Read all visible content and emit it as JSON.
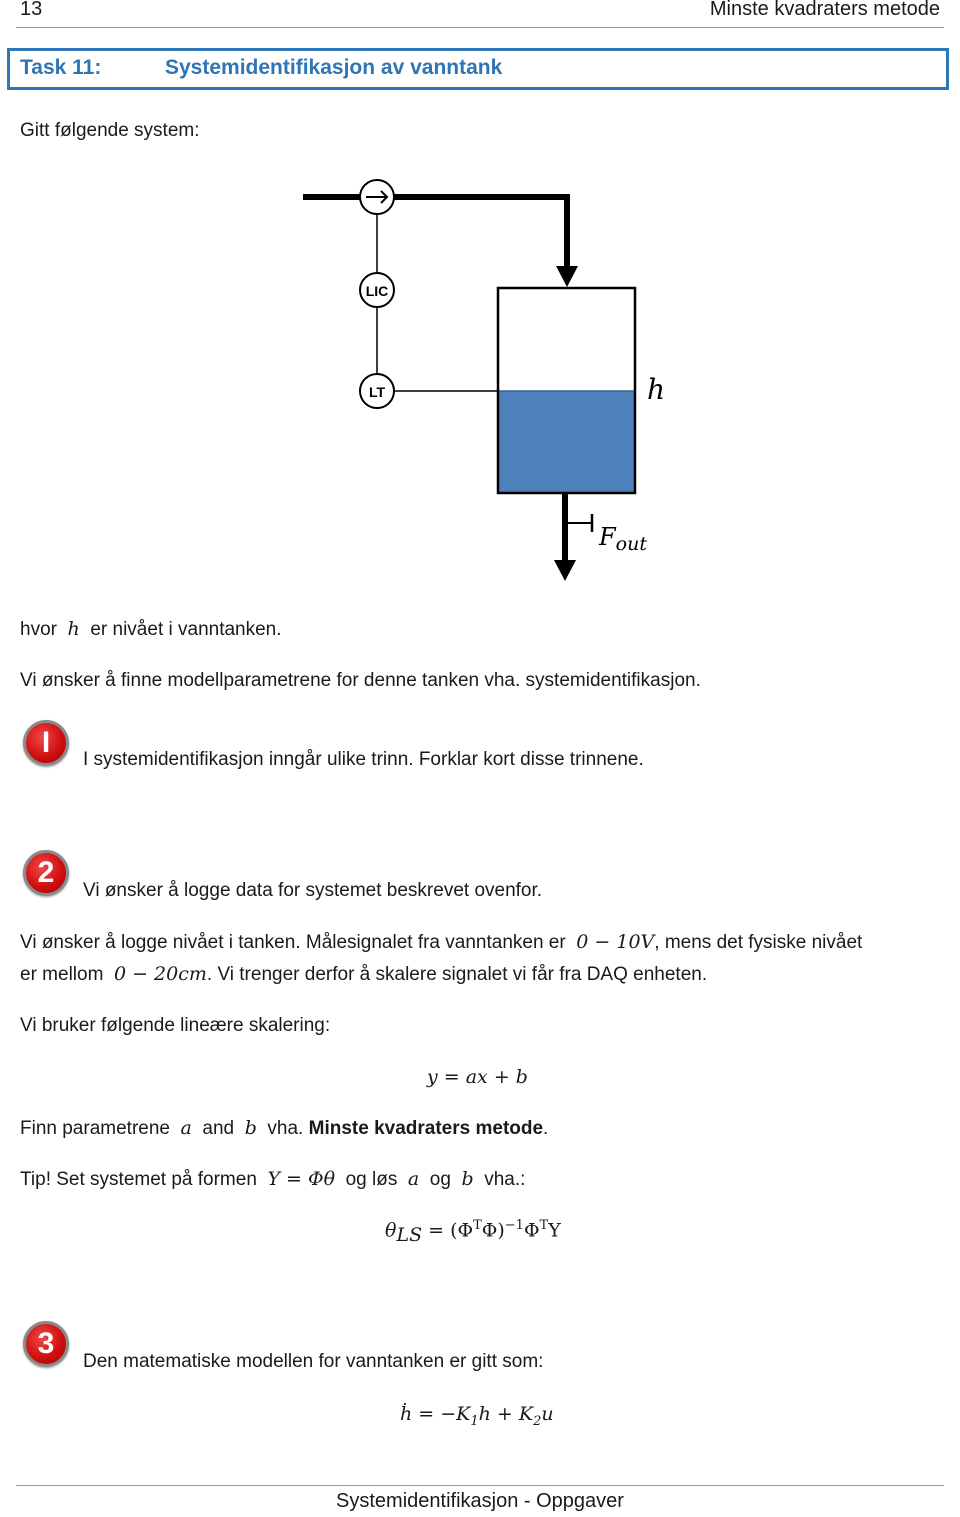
{
  "header": {
    "page_number": "13",
    "title": "Minste kvadraters metode"
  },
  "task": {
    "label": "Task 11:",
    "title": "Systemidentifikasjon av vanntank"
  },
  "intro": "Gitt følgende system:",
  "diagram": {
    "instruments": [
      "LIC",
      "LT"
    ],
    "level_label": "h",
    "outflow_label": "F",
    "outflow_subscript": "out",
    "water_color": "#4f81bd"
  },
  "para_h": {
    "before": "hvor",
    "var": "h",
    "after": "er nivået i vanntanken."
  },
  "para_goal": "Vi ønsker å finne modellparametrene for denne tanken vha. systemidentifikasjon.",
  "steps": [
    {
      "badge": "I",
      "text": "I systemidentifikasjon inngår ulike trinn. Forklar kort disse trinnene."
    },
    {
      "badge": "2",
      "text": "Vi ønsker å logge data for systemet beskrevet ovenfor."
    },
    {
      "badge": "3",
      "text": "Den matematiske modellen for vanntanken er gitt som:"
    }
  ],
  "step2": {
    "line1_a": "Vi ønsker å logge nivået i tanken. Målesignalet fra vanntanken er",
    "line1_math": "0 − 10V",
    "line1_b": ", mens det fysiske nivået",
    "line2_a": "er mellom",
    "line2_math": "0 − 20cm",
    "line2_b": ". Vi trenger derfor å skalere signalet vi får fra DAQ enheten.",
    "scaling_intro": "Vi bruker følgende lineære skalering:",
    "equation": "y = ax + b",
    "find_a": "Finn parametrene",
    "var_a": "a",
    "and": "and",
    "var_b": "b",
    "vha": "vha.",
    "method": "Minste kvadraters metode",
    "period": ".",
    "tip_a": "Tip! Set systemet på formen",
    "tip_math": "Y = Φθ",
    "tip_b": "og løs",
    "tip_var_a": "a",
    "tip_og": "og",
    "tip_var_b": "b",
    "tip_c": "vha.:",
    "ls_lhs": "θ",
    "ls_sub": "LS",
    "ls_rhs_1": "= (Φ",
    "ls_sup_T1": "T",
    "ls_rhs_2": "Φ)",
    "ls_sup_inv": "−1",
    "ls_rhs_3": "Φ",
    "ls_sup_T2": "T",
    "ls_rhs_4": "Y"
  },
  "step3": {
    "eq_hdot": "ḣ",
    "eq_1": " = −K",
    "eq_sub1": "1",
    "eq_2": "h + K",
    "eq_sub2": "2",
    "eq_3": "u"
  },
  "footer": {
    "title": "Systemidentifikasjon - Oppgaver"
  }
}
